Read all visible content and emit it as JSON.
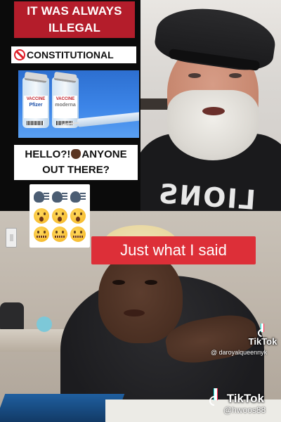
{
  "meme": {
    "title_line1": "IT WAS ALWAYS",
    "title_line2": "ILLEGAL",
    "constitutional_label": "CONSTITUTIONAL",
    "vial1_label": "VACCINE",
    "vial1_brand": "Pfizer",
    "vial2_label": "VACCINE",
    "vial2_brand": "moderna",
    "hello_line1_a": "HELLO?!",
    "hello_line1_b": "ANYONE",
    "hello_line2": "OUT THERE?",
    "emoji_grid": [
      "speaking-head-icon",
      "speaking-head-icon",
      "speaking-head-icon",
      "open-mouth-face-icon",
      "open-mouth-face-icon",
      "open-mouth-face-icon",
      "zipper-mouth-face-icon",
      "zipper-mouth-face-icon",
      "zipper-mouth-face-icon"
    ]
  },
  "man_panel": {
    "shirt_text": "LIONS"
  },
  "bottom_panel": {
    "caption": "Just what I said"
  },
  "watermarks": {
    "tiktok1_brand": "TikTok",
    "tiktok1_user": "@ daroyalqueennyk",
    "tiktok2_brand": "TikTok",
    "tiktok2_user": "@hwoos88"
  },
  "colors": {
    "title_red": "#b41d2b",
    "caption_red": "#dd2f38",
    "tiktok_cyan": "#25f4ee",
    "tiktok_pink": "#fe2c55"
  }
}
